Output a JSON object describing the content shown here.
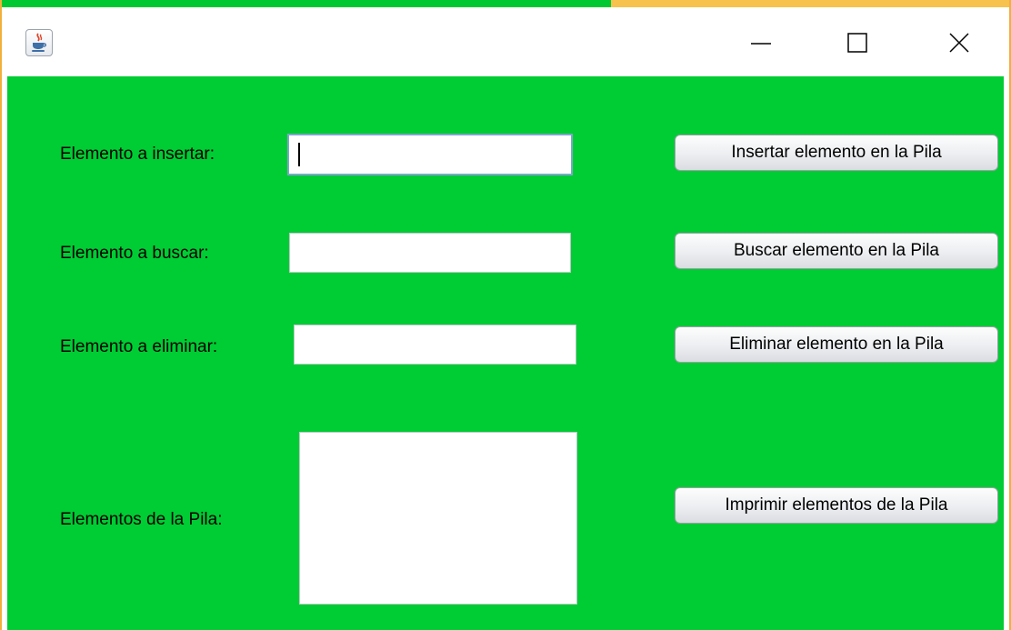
{
  "window": {
    "app_icon": "java-coffee-icon",
    "controls": [
      "minimize-icon",
      "maximize-icon",
      "close-icon"
    ]
  },
  "colors": {
    "panel_background": "#00cc33",
    "window_border": "#f2b03a"
  },
  "form": {
    "insert_label": "Elemento a insertar:",
    "insert_value": "",
    "search_label": "Elemento a buscar:",
    "search_value": "",
    "delete_label": "Elemento a eliminar:",
    "delete_value": "",
    "stack_label": "Elementos de la Pila:",
    "stack_contents": ""
  },
  "buttons": {
    "insert": "Insertar elemento en la Pila",
    "search": "Buscar elemento en la Pila",
    "delete": "Eliminar elemento en la Pila",
    "print": "Imprimir elementos de la Pila"
  }
}
